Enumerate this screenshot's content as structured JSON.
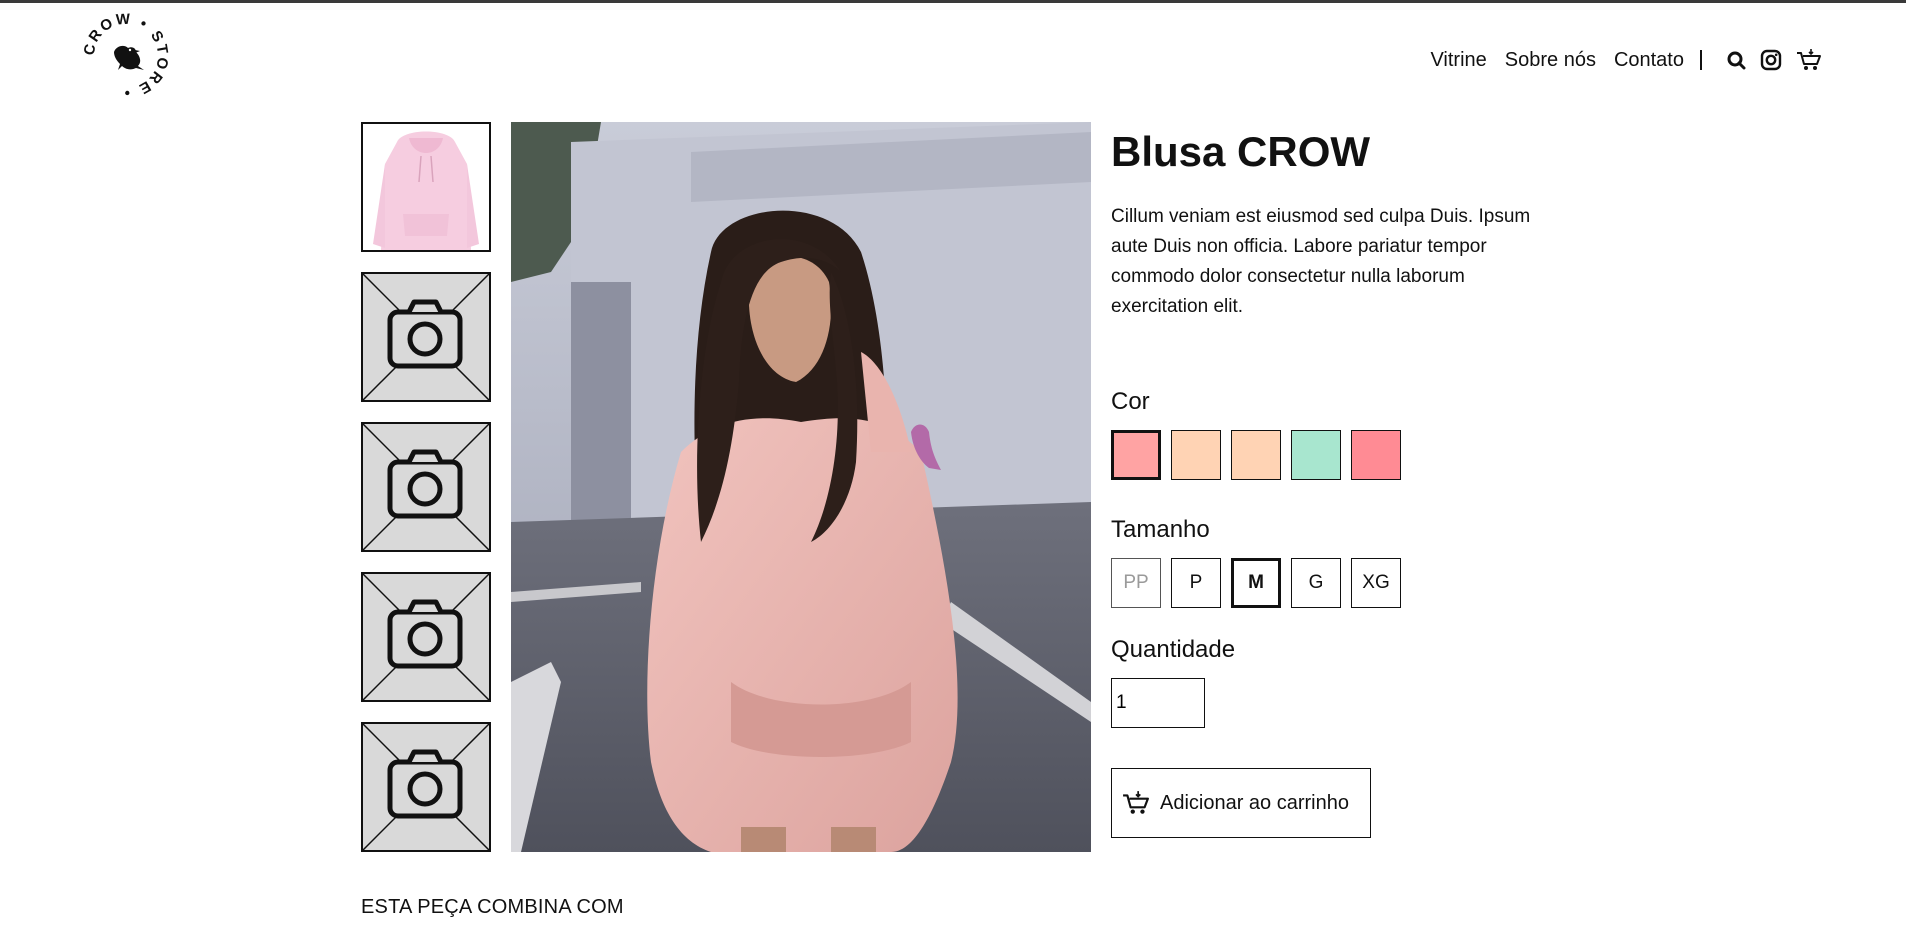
{
  "header": {
    "logo_text": "CROW • STORE •",
    "nav": [
      {
        "label": "Vitrine"
      },
      {
        "label": "Sobre nós"
      },
      {
        "label": "Contato"
      }
    ],
    "icons": [
      "search-icon",
      "instagram-icon",
      "cart-icon"
    ]
  },
  "gallery": {
    "thumbnails": [
      "pink-hoodie-photo",
      "camera-placeholder",
      "camera-placeholder",
      "camera-placeholder",
      "camera-placeholder"
    ]
  },
  "product": {
    "title": "Blusa CROW",
    "description": "Cillum veniam est eiusmod sed culpa Duis. Ipsum aute Duis non officia. Labore pariatur tempor commodo dolor consectetur nulla laborum exercitation elit.",
    "color_label": "Cor",
    "colors": [
      {
        "hex": "#ffa3a3",
        "selected": true
      },
      {
        "hex": "#ffd3b4",
        "selected": false
      },
      {
        "hex": "#ffd3b4",
        "selected": false
      },
      {
        "hex": "#a8e6cf",
        "selected": false
      },
      {
        "hex": "#ff8b94",
        "selected": false
      }
    ],
    "size_label": "Tamanho",
    "sizes": [
      {
        "label": "PP",
        "state": "disabled"
      },
      {
        "label": "P",
        "state": "normal"
      },
      {
        "label": "M",
        "state": "selected"
      },
      {
        "label": "G",
        "state": "normal"
      },
      {
        "label": "XG",
        "state": "normal"
      }
    ],
    "quantity_label": "Quantidade",
    "quantity_value": "1",
    "add_to_cart_label": "Adicionar ao carrinho"
  },
  "related": {
    "heading": "ESTA PEÇA COMBINA COM"
  }
}
